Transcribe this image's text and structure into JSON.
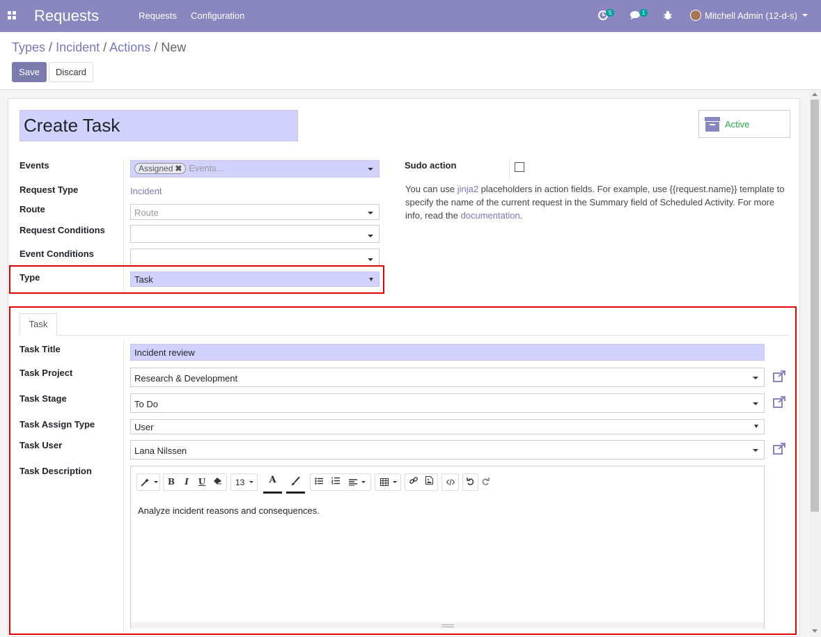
{
  "navbar": {
    "app_title": "Requests",
    "menu": [
      "Requests",
      "Configuration"
    ],
    "activity_count": "5",
    "message_count": "1",
    "user_name": "Mitchell Admin (12-d-s)"
  },
  "breadcrumb": {
    "items": [
      "Types",
      "Incident",
      "Actions"
    ],
    "current": "New",
    "separator": "/"
  },
  "buttons": {
    "save": "Save",
    "discard": "Discard"
  },
  "form": {
    "name": "Create Task",
    "active_label": "Active",
    "events_label": "Events",
    "events_tag": "Assigned",
    "events_placeholder": "Events...",
    "request_type_label": "Request Type",
    "request_type_value": "Incident",
    "route_label": "Route",
    "route_placeholder": "Route",
    "request_conditions_label": "Request Conditions",
    "event_conditions_label": "Event Conditions",
    "type_label": "Type",
    "type_value": "Task",
    "sudo_label": "Sudo action",
    "help_part1": "You can use ",
    "help_link1": "jinja2",
    "help_part2": " placeholders in action fields. For example, use {{request.name}} template to specify the name of the current request in the Summary field of Scheduled Activity. For more info, read the ",
    "help_link2": "documentation",
    "help_part3": "."
  },
  "task_tab": {
    "tab_label": "Task",
    "title_label": "Task Title",
    "title_value": "Incident review",
    "project_label": "Task Project",
    "project_value": "Research & Development",
    "stage_label": "Task Stage",
    "stage_value": "To Do",
    "assign_type_label": "Task Assign Type",
    "assign_type_value": "User",
    "user_label": "Task User",
    "user_value": "Lana Nilssen",
    "description_label": "Task Description",
    "font_size": "13",
    "description_text": "Analyze incident reasons and consequences."
  },
  "colors": {
    "navbar": "#8a86c0",
    "primary": "#7c7bad",
    "required_field": "#d2d2ff",
    "highlight": "#e10000",
    "active": "#28a745"
  }
}
